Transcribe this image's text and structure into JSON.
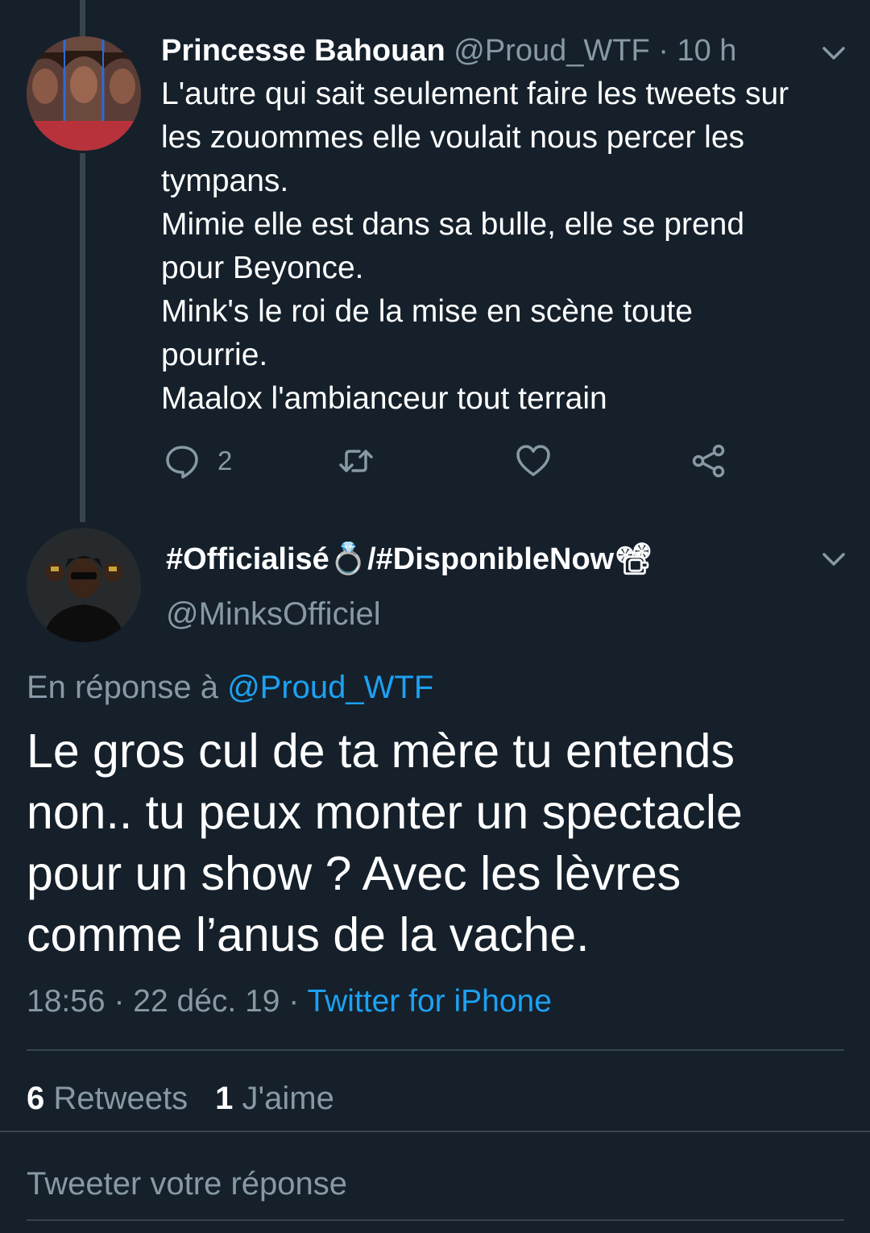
{
  "tweet1": {
    "name": "Princesse Bahouan",
    "handle": "@Proud_WTF",
    "separator": "·",
    "time": "10 h",
    "lines": [
      "L'autre qui sait seulement faire les tweets sur",
      "les zouommes elle voulait nous percer les",
      "tympans.",
      "Mimie elle est dans sa bulle, elle se prend",
      "pour Beyonce.",
      "Mink's le roi de la mise en scène toute",
      "pourrie.",
      "Maalox l'ambianceur tout terrain"
    ],
    "reply_count": "2"
  },
  "tweet2": {
    "name": "#Officialisé💍/#DisponibleNow📽",
    "handle": "@MinksOfficiel",
    "reply_prefix": "En réponse à",
    "reply_handle": "@Proud_WTF",
    "lines": [
      "Le gros cul de ta mère tu entends",
      "non.. tu peux monter un spectacle",
      "pour un show ? Avec les lèvres",
      "comme l’anus de la vache."
    ],
    "time": "18:56",
    "date": "22 déc. 19",
    "source": "Twitter for iPhone",
    "retweets_count": "6",
    "retweets_label": "Retweets",
    "likes_count": "1",
    "likes_label": "J'aime"
  },
  "composer": {
    "placeholder": "Tweeter votre réponse"
  },
  "colors": {
    "background": "#15202b",
    "muted": "#8899a6",
    "link": "#1da1f2",
    "divider": "#38444d"
  },
  "icons": [
    "chevron-down-icon",
    "reply-icon",
    "retweet-icon",
    "like-icon",
    "share-icon"
  ]
}
